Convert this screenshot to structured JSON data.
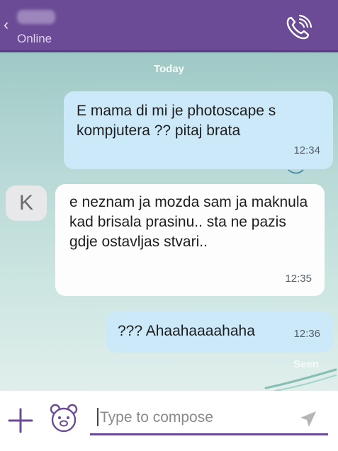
{
  "header": {
    "back_icon": "chevron-left-icon",
    "contact_name": "",
    "status": "Online",
    "call_icon": "phone-call-icon",
    "background": "#6c4b96"
  },
  "chat": {
    "date_separator": "Today",
    "messages": [
      {
        "direction": "outgoing",
        "text": "E mama di mi je photoscape s kompjutera ?? pitaj brata",
        "time": "12:34"
      },
      {
        "direction": "incoming",
        "avatar_letter": "K",
        "text": "e neznam ja mozda sam ja maknula kad brisala prasinu.. sta ne pazis gdje ostavljas stvari..",
        "time": "12:35"
      },
      {
        "direction": "outgoing",
        "text": "??? Ahaahaaaahaha",
        "time": "12:36"
      }
    ],
    "seen_label": "Seen"
  },
  "composer": {
    "add_icon": "plus-icon",
    "sticker_icon": "bear-sticker-icon",
    "placeholder": "Type to compose",
    "send_icon": "send-icon"
  },
  "colors": {
    "accent": "#6c4b96",
    "outgoing_bubble": "#cce9f9",
    "incoming_bubble": "#fdfdfd"
  }
}
